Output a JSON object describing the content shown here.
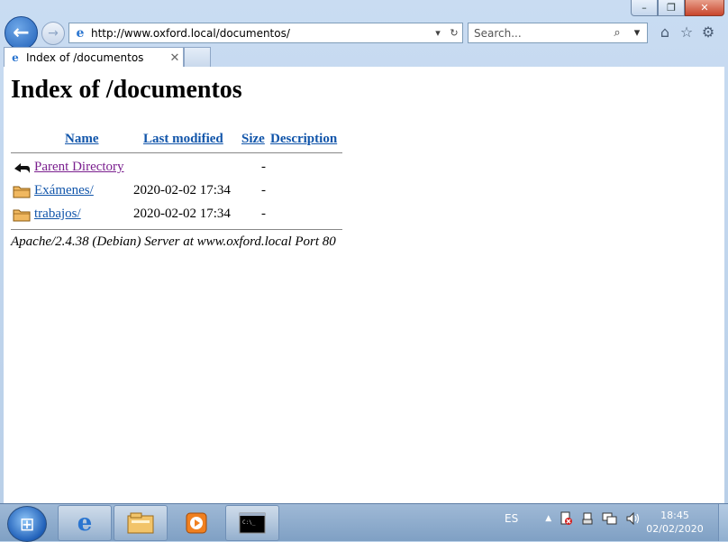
{
  "browser": {
    "window_buttons": {
      "minimize": "–",
      "maximize": "❐",
      "close": "✕"
    },
    "back_glyph": "←",
    "forward_glyph": "→",
    "address": "http://www.oxford.local/documentos/",
    "address_dropdown": "▾",
    "refresh_glyph": "↻",
    "search_placeholder": "Search...",
    "search_icon": "⌕",
    "search_dropdown": "▾",
    "tools": {
      "home": "⌂",
      "favorites": "☆",
      "settings": "⚙"
    },
    "tab_title": "Index of /documentos",
    "tab_close": "✕"
  },
  "page": {
    "title": "Index of /documentos",
    "columns": {
      "name": "Name",
      "last_modified": "Last modified",
      "size": "Size",
      "description": "Description"
    },
    "rows": [
      {
        "icon": "back-arrow-icon",
        "name": "Parent Directory",
        "modified": "",
        "size": "-"
      },
      {
        "icon": "folder-icon",
        "name": "Exámenes/",
        "modified": "2020-02-02 17:34",
        "size": "-"
      },
      {
        "icon": "folder-icon",
        "name": "trabajos/",
        "modified": "2020-02-02 17:34",
        "size": "-"
      }
    ],
    "footer": "Apache/2.4.38 (Debian) Server at www.oxford.local Port 80"
  },
  "taskbar": {
    "language": "ES",
    "tray_arrow": "▲",
    "time": "18:45",
    "date": "02/02/2020"
  },
  "colors": {
    "link": "#1155aa",
    "visited": "#7a1f8e",
    "accent": "#1f5fb8"
  }
}
